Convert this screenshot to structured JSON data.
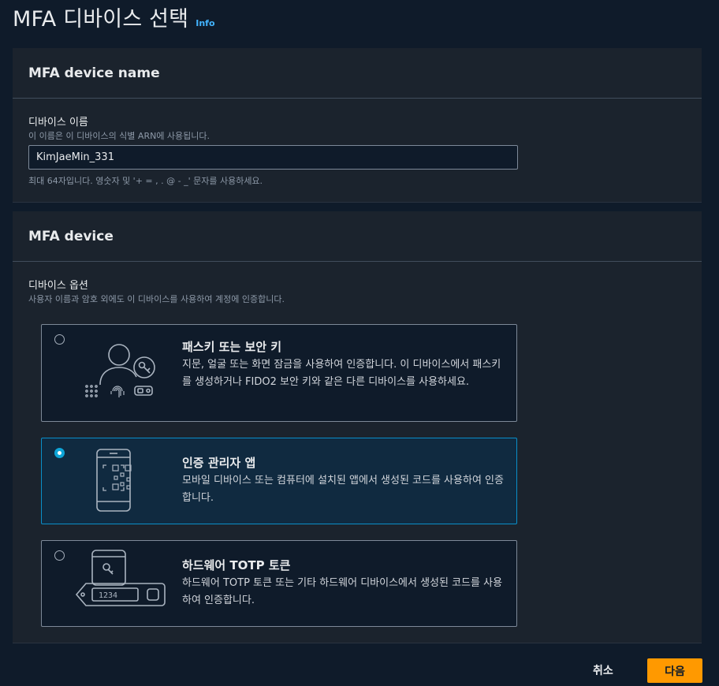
{
  "page": {
    "title": "MFA 디바이스 선택",
    "info_label": "Info"
  },
  "device_name_section": {
    "heading": "MFA device name",
    "field_label": "디바이스 이름",
    "field_description": "이 이름은 이 디바이스의 식별 ARN에 사용됩니다.",
    "input_value": "KimJaeMin_331",
    "constraint_hint": "최대 64자입니다. 영숫자 및 '+ = , . @ - _' 문자를 사용하세요."
  },
  "device_section": {
    "heading": "MFA device",
    "field_label": "디바이스 옵션",
    "field_description": "사용자 이름과 암호 외에도 이 디바이스를 사용하여 계정에 인증합니다.",
    "options": [
      {
        "title": "패스키 또는 보안 키",
        "description": "지문, 얼굴 또는 화면 잠금을 사용하여 인증합니다. 이 디바이스에서 패스키를 생성하거나 FIDO2 보안 키와 같은 다른 디바이스를 사용하세요.",
        "selected": false,
        "icon": "passkey-illustration"
      },
      {
        "title": "인증 관리자 앱",
        "description": "모바일 디바이스 또는 컴퓨터에 설치된 앱에서 생성된 코드를 사용하여 인증합니다.",
        "selected": true,
        "icon": "authenticator-app-illustration"
      },
      {
        "title": "하드웨어 TOTP 토큰",
        "description": "하드웨어 TOTP 토큰 또는 기타 하드웨어 디바이스에서 생성된 코드를 사용하여 인증합니다.",
        "selected": false,
        "icon": "hardware-token-illustration",
        "token_display": "1234"
      }
    ]
  },
  "footer": {
    "cancel_label": "취소",
    "next_label": "다음"
  },
  "colors": {
    "accent": "#ff9900",
    "selected_border": "#0a8fc9",
    "info_link": "#42b4ff"
  }
}
